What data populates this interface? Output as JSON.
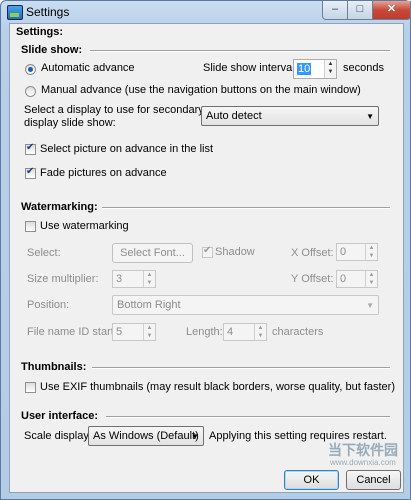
{
  "window": {
    "title": "Settings",
    "min_glyph": "–",
    "max_glyph": "□",
    "close_glyph": "✕"
  },
  "heading": "Settings:",
  "slideshow": {
    "section_label": "Slide show:",
    "auto_advance_label": "Automatic advance",
    "auto_advance_selected": true,
    "manual_advance_label": "Manual advance (use the navigation buttons on the main window)",
    "interval_label": "Slide show interval:",
    "interval_value": "10",
    "interval_unit": "seconds",
    "display_label_line1": "Select a display to use for secondary",
    "display_label_line2": "display slide show:",
    "display_value": "Auto detect",
    "select_picture_label": "Select picture on advance in the list",
    "select_picture_checked": true,
    "fade_label": "Fade pictures on advance",
    "fade_checked": true
  },
  "watermarking": {
    "section_label": "Watermarking:",
    "use_label": "Use watermarking",
    "use_checked": false,
    "select_label": "Select:",
    "select_font_button": "Select Font...",
    "shadow_label": "Shadow",
    "shadow_checked": true,
    "x_offset_label": "X Offset:",
    "x_offset_value": "0",
    "size_multiplier_label": "Size multiplier:",
    "size_multiplier_value": "3",
    "y_offset_label": "Y Offset:",
    "y_offset_value": "0",
    "position_label": "Position:",
    "position_value": "Bottom Right",
    "file_id_label": "File name ID start:",
    "file_id_value": "5",
    "length_label": "Length:",
    "length_value": "4",
    "length_unit": "characters"
  },
  "thumbnails": {
    "section_label": "Thumbnails:",
    "exif_label": "Use EXIF thumbnails (may result black borders, worse quality, but faster)",
    "exif_checked": false
  },
  "ui": {
    "section_label": "User interface:",
    "scale_label": "Scale display:",
    "scale_value": "As Windows (Default)",
    "restart_note": "Applying this setting requires restart."
  },
  "buttons": {
    "ok": "OK",
    "cancel": "Cancel"
  },
  "watermark_overlay": {
    "text": "当下软件园",
    "url": "www.downxia.com"
  }
}
